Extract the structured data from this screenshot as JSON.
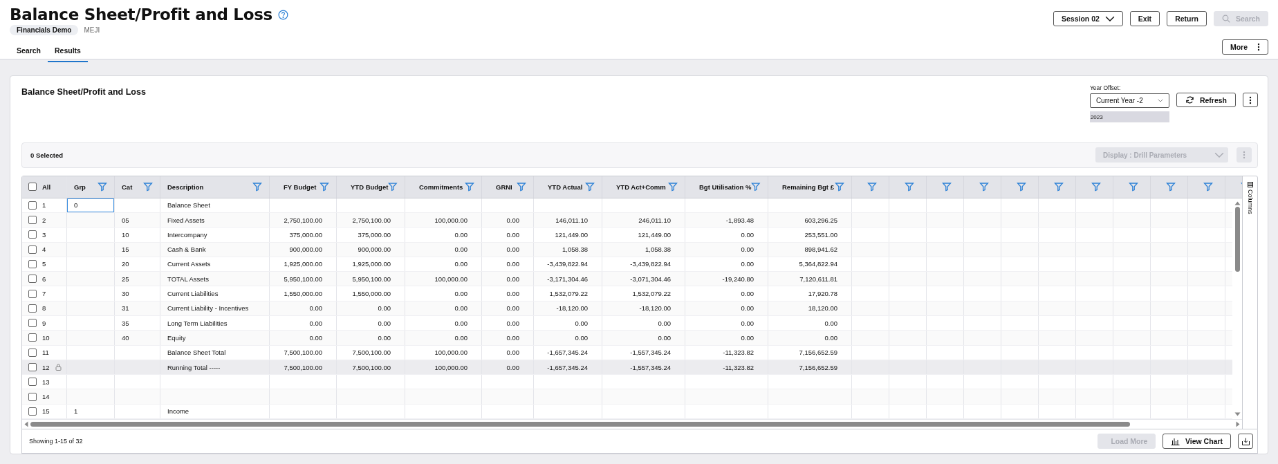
{
  "page": {
    "title": "Balance Sheet/Profit and Loss",
    "company": "Financials Demo",
    "user": "MEJI"
  },
  "header_buttons": [
    {
      "label": "Session 02",
      "kind": "dropdown",
      "disabled": false
    },
    {
      "label": "Exit",
      "kind": "plain",
      "disabled": false
    },
    {
      "label": "Return",
      "kind": "plain",
      "disabled": false
    },
    {
      "label": "Search",
      "kind": "search",
      "disabled": true
    }
  ],
  "more_button": {
    "label": "More"
  },
  "tabs": [
    {
      "label": "Search",
      "selected": false
    },
    {
      "label": "Results",
      "selected": true
    }
  ],
  "panel": {
    "title": "Balance Sheet/Profit and Loss",
    "year_offset": {
      "label": "Year Offset:",
      "value": "Current Year -2",
      "year": "2023"
    },
    "refresh_button": {
      "label": "Refresh"
    }
  },
  "toolbar": {
    "selected_count": "0 Selected",
    "display_dropdown": {
      "label": "Display : Drill Parameters",
      "disabled": true
    }
  },
  "table": {
    "select_all": {
      "label": "All",
      "checked": false
    },
    "columns": [
      {
        "label": "Grp",
        "kind": "text"
      },
      {
        "label": "Cat",
        "kind": "text"
      },
      {
        "label": "Description",
        "kind": "text"
      },
      {
        "label": "FY Budget",
        "kind": "number"
      },
      {
        "label": "YTD Budget",
        "kind": "number"
      },
      {
        "label": "Commitments",
        "kind": "number"
      },
      {
        "label": "GRNI",
        "kind": "number"
      },
      {
        "label": "YTD Actual",
        "kind": "number"
      },
      {
        "label": "YTD Act+Comm",
        "kind": "number"
      },
      {
        "label": "Bgt Utilisation %",
        "kind": "number"
      },
      {
        "label": "Remaining Bgt £",
        "kind": "number"
      }
    ],
    "rows": [
      {
        "number": "1",
        "checked": false,
        "locked": false,
        "focused": true,
        "grp": "0",
        "description": "Balance Sheet"
      },
      {
        "number": "2",
        "checked": false,
        "locked": false,
        "focused": false,
        "cat": "05",
        "description": "Fixed Assets",
        "values": [
          "2,750,100.00",
          "2,750,100.00",
          "100,000.00",
          "0.00",
          "146,011.10",
          "246,011.10",
          "-1,893.48",
          "603,296.25"
        ]
      },
      {
        "number": "3",
        "checked": false,
        "locked": false,
        "focused": false,
        "cat": "10",
        "description": "Intercompany",
        "values": [
          "375,000.00",
          "375,000.00",
          "0.00",
          "0.00",
          "121,449.00",
          "121,449.00",
          "0.00",
          "253,551.00"
        ]
      },
      {
        "number": "4",
        "checked": false,
        "locked": false,
        "focused": false,
        "cat": "15",
        "description": "Cash & Bank",
        "values": [
          "900,000.00",
          "900,000.00",
          "0.00",
          "0.00",
          "1,058.38",
          "1,058.38",
          "0.00",
          "898,941.62"
        ]
      },
      {
        "number": "5",
        "checked": false,
        "locked": false,
        "focused": false,
        "cat": "20",
        "description": "Current Assets",
        "values": [
          "1,925,000.00",
          "1,925,000.00",
          "0.00",
          "0.00",
          "-3,439,822.94",
          "-3,439,822.94",
          "0.00",
          "5,364,822.94"
        ]
      },
      {
        "number": "6",
        "checked": false,
        "locked": false,
        "focused": false,
        "cat": "25",
        "description": "TOTAL Assets",
        "values": [
          "5,950,100.00",
          "5,950,100.00",
          "100,000.00",
          "0.00",
          "-3,171,304.46",
          "-3,071,304.46",
          "-19,240.80",
          "7,120,611.81"
        ]
      },
      {
        "number": "7",
        "checked": false,
        "locked": false,
        "focused": false,
        "cat": "30",
        "description": "Current Liabilities",
        "values": [
          "1,550,000.00",
          "1,550,000.00",
          "0.00",
          "0.00",
          "1,532,079.22",
          "1,532,079.22",
          "0.00",
          "17,920.78"
        ]
      },
      {
        "number": "8",
        "checked": false,
        "locked": false,
        "focused": false,
        "cat": "31",
        "description": "Current Liability - Incentives",
        "values": [
          "0.00",
          "0.00",
          "0.00",
          "0.00",
          "-18,120.00",
          "-18,120.00",
          "0.00",
          "18,120.00"
        ]
      },
      {
        "number": "9",
        "checked": false,
        "locked": false,
        "focused": false,
        "cat": "35",
        "description": "Long Term Liabilities",
        "values": [
          "0.00",
          "0.00",
          "0.00",
          "0.00",
          "0.00",
          "0.00",
          "0.00",
          "0.00"
        ]
      },
      {
        "number": "10",
        "checked": false,
        "locked": false,
        "focused": false,
        "cat": "40",
        "description": "Equity",
        "values": [
          "0.00",
          "0.00",
          "0.00",
          "0.00",
          "0.00",
          "0.00",
          "0.00",
          "0.00"
        ]
      },
      {
        "number": "11",
        "checked": false,
        "locked": false,
        "focused": false,
        "description": "Balance Sheet Total",
        "values": [
          "7,500,100.00",
          "7,500,100.00",
          "100,000.00",
          "0.00",
          "-1,657,345.24",
          "-1,557,345.24",
          "-11,323.82",
          "7,156,652.59"
        ]
      },
      {
        "number": "12",
        "checked": false,
        "locked": true,
        "focused": false,
        "description": "Running Total -----",
        "values": [
          "7,500,100.00",
          "7,500,100.00",
          "100,000.00",
          "0.00",
          "-1,657,345.24",
          "-1,557,345.24",
          "-11,323.82",
          "7,156,652.59"
        ]
      },
      {
        "number": "13",
        "checked": false,
        "locked": false,
        "focused": false
      },
      {
        "number": "14",
        "checked": false,
        "locked": false,
        "focused": false
      },
      {
        "number": "15",
        "checked": false,
        "locked": false,
        "focused": false,
        "grp": "1",
        "description": "Income"
      }
    ]
  },
  "side_panel": {
    "label": "Columns"
  },
  "footer": {
    "showing": "Showing 1-15 of 32",
    "load_more": {
      "label": "Load More",
      "disabled": true
    },
    "view_chart": {
      "label": "View Chart"
    }
  }
}
